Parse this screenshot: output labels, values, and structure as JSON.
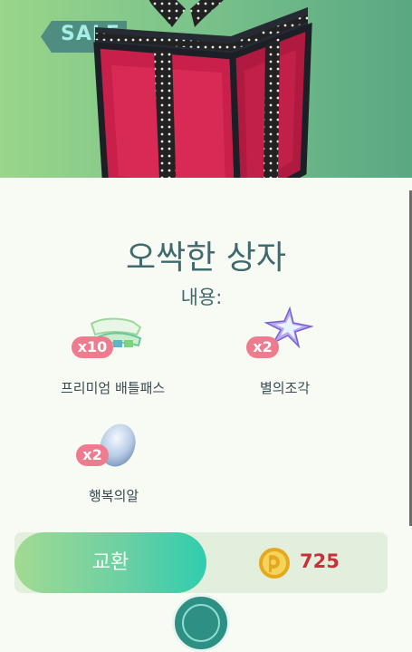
{
  "hero": {
    "sale_label": "SALE"
  },
  "box": {
    "title": "오싹한 상자",
    "contents_label": "내용:"
  },
  "items": [
    {
      "name": "프리미엄 배틀패스",
      "quantity": "x10",
      "icon": "premium-battle-pass-icon"
    },
    {
      "name": "별의조각",
      "quantity": "x2",
      "icon": "star-piece-icon"
    },
    {
      "name": "행복의알",
      "quantity": "x2",
      "icon": "lucky-egg-icon"
    }
  ],
  "purchase": {
    "button_label": "교환",
    "price": "725",
    "currency_icon": "pokecoin-icon"
  },
  "colors": {
    "accent": "#2fcdae",
    "price": "#c8313b",
    "badge": "#ef7b8e",
    "title": "#3f6a6e"
  }
}
